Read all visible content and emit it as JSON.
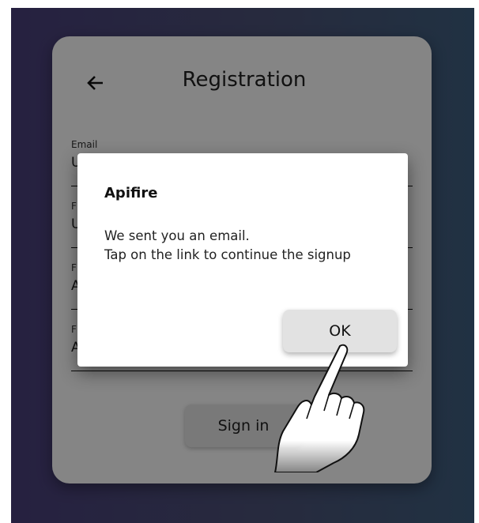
{
  "header": {
    "title": "Registration",
    "back_icon": "arrow-left-icon"
  },
  "form": {
    "email_label": "Email",
    "email_value": "U",
    "field2_label": "F",
    "field2_value": "U",
    "field3_label": "F",
    "field3_value": "A",
    "field4_label": "F",
    "field4_value": "A",
    "signin_label": "Sign in"
  },
  "dialog": {
    "title": "Apifire",
    "message_line1": "We sent you an email.",
    "message_line2": "Tap on the link to continue the signup",
    "ok_label": "OK"
  },
  "colors": {
    "background_start": "#4a3f7c",
    "background_end": "#3f5f80",
    "scrim": "rgba(0,0,0,0.48)"
  }
}
